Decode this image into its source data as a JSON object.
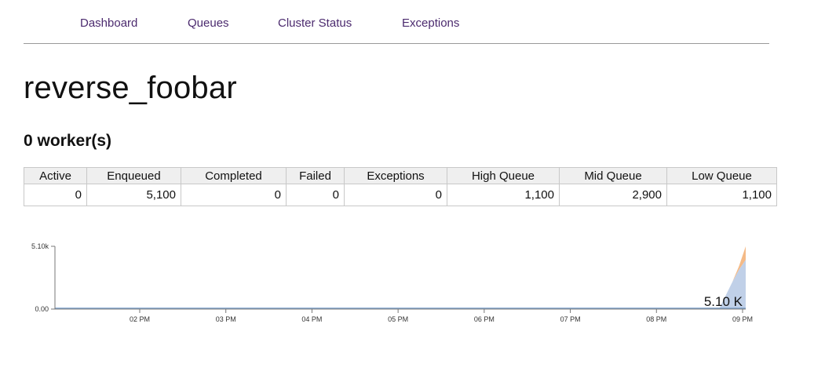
{
  "nav": {
    "items": [
      {
        "label": "Dashboard"
      },
      {
        "label": "Queues"
      },
      {
        "label": "Cluster Status"
      },
      {
        "label": "Exceptions"
      }
    ]
  },
  "page": {
    "title": "reverse_foobar",
    "workers_text": "0 worker(s)"
  },
  "stats": {
    "headers": [
      "Active",
      "Enqueued",
      "Completed",
      "Failed",
      "Exceptions",
      "High Queue",
      "Mid Queue",
      "Low Queue"
    ],
    "values": [
      "0",
      "5,100",
      "0",
      "0",
      "0",
      "1,100",
      "2,900",
      "1,100"
    ]
  },
  "chart_data": {
    "type": "area",
    "x_tick_labels": [
      "02 PM",
      "03 PM",
      "04 PM",
      "05 PM",
      "06 PM",
      "07 PM",
      "08 PM",
      "09 PM"
    ],
    "y_tick_labels": [
      "5.10k",
      "0.00"
    ],
    "ylim": [
      0,
      5100
    ],
    "annotation": "5.10 K",
    "grid": false,
    "colors": {
      "low_area": "#b9cbe6",
      "high_area": "#f3b27a",
      "line": "#7fa4cf",
      "axis": "#777777"
    },
    "series": [
      {
        "values": [
          0,
          0,
          0,
          0,
          0,
          0,
          0,
          0,
          1100,
          2200,
          3200,
          4000
        ]
      },
      {
        "values": [
          0,
          0,
          0,
          0,
          0,
          0,
          0,
          0,
          0,
          0,
          300,
          1100
        ]
      }
    ]
  }
}
